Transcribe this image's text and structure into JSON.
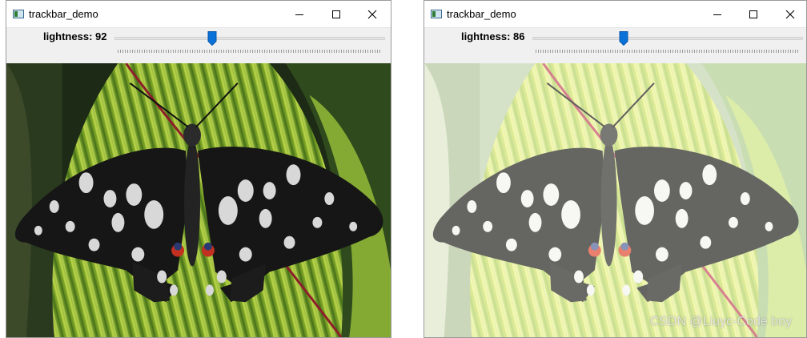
{
  "windows": [
    {
      "title": "trackbar_demo",
      "trackbar": {
        "label": "lightness: 92",
        "value": 92,
        "max": 255
      },
      "icons": {
        "app": "window-app-icon",
        "minimize": "minimize-icon",
        "maximize": "maximize-icon",
        "close": "close-icon"
      }
    },
    {
      "title": "trackbar_demo",
      "trackbar": {
        "label": "lightness: 86",
        "value": 86,
        "max": 255
      },
      "icons": {
        "app": "window-app-icon",
        "minimize": "minimize-icon",
        "maximize": "maximize-icon",
        "close": "close-icon"
      }
    }
  ],
  "image": {
    "subject": "butterfly-on-leaf-photo"
  },
  "watermark": "CSDN @Liuyc-Code boy",
  "colors": {
    "thumb": "#0a72d8",
    "pane": "#f0f0f0"
  }
}
